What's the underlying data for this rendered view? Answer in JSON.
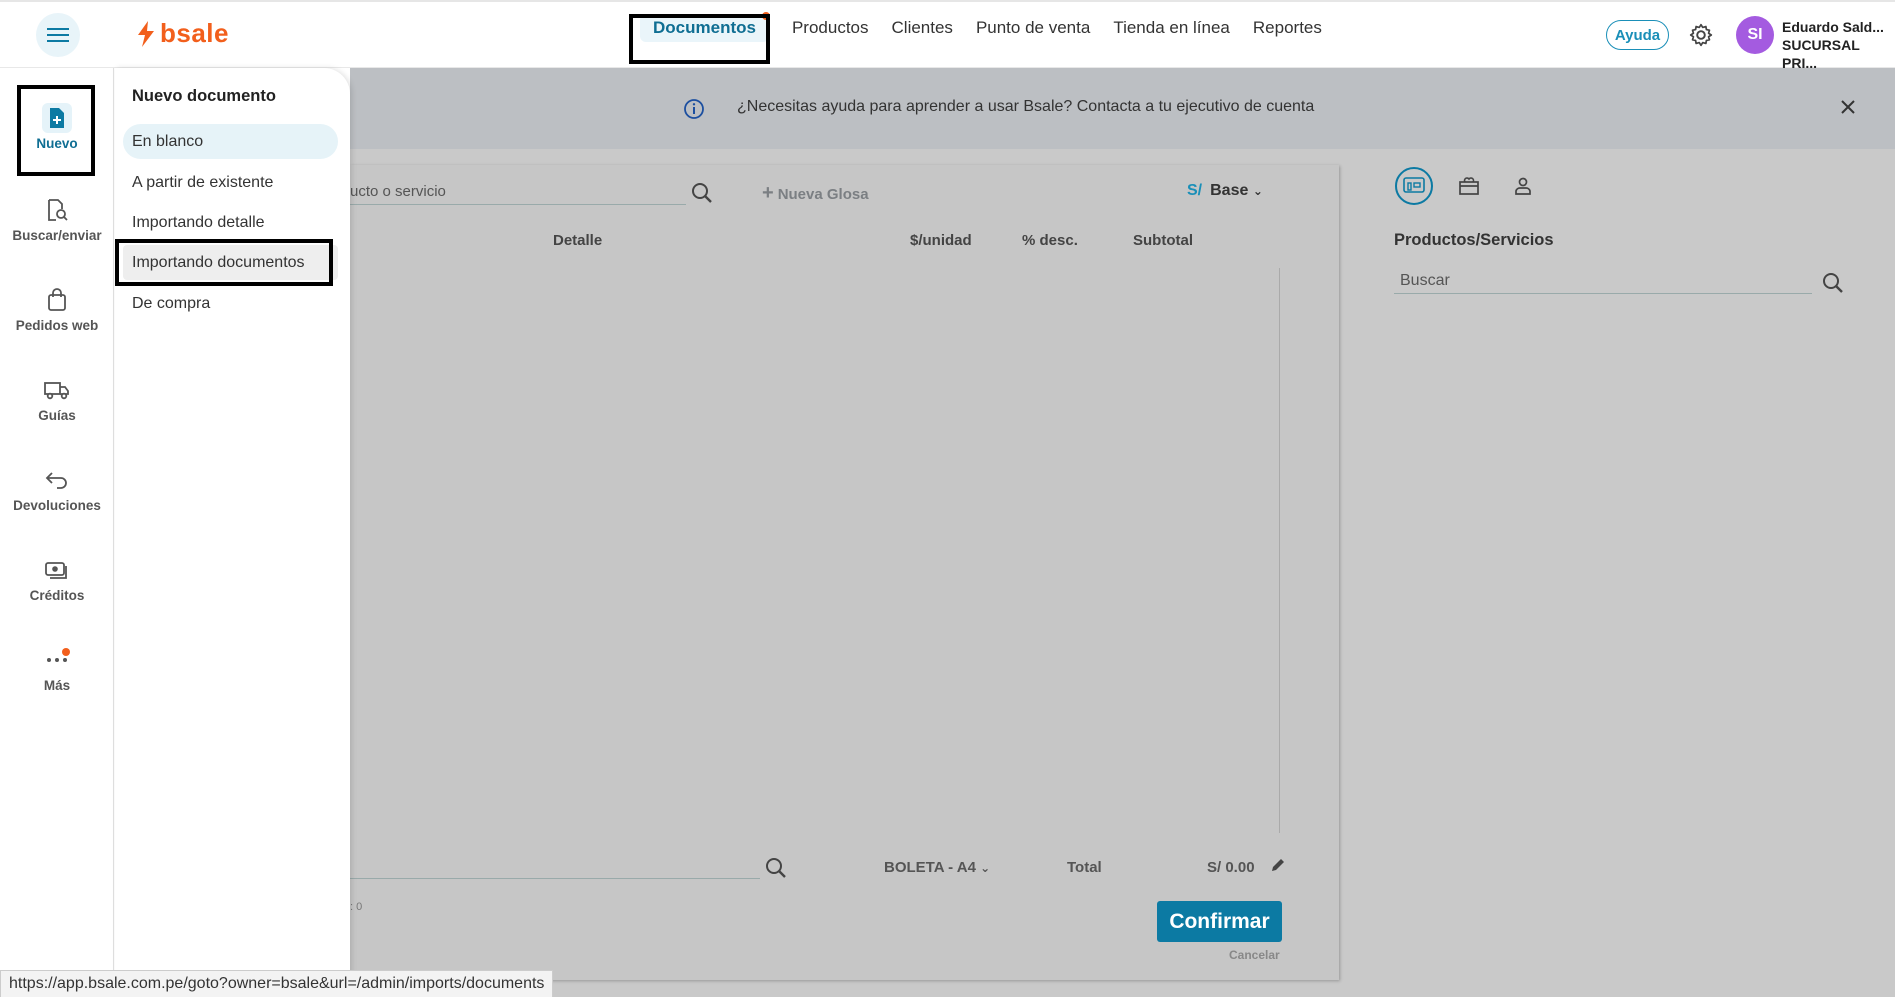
{
  "brand": {
    "name": "bsale",
    "color": "#f25f1c"
  },
  "topnav": {
    "items": [
      "Documentos",
      "Productos",
      "Clientes",
      "Punto de venta",
      "Tienda en línea",
      "Reportes"
    ],
    "active": "Documentos"
  },
  "header": {
    "help_label": "Ayuda",
    "avatar_initials": "SI",
    "user_name": "Eduardo Sald...",
    "branch": "SUCURSAL PRI..."
  },
  "sidebar": {
    "items": [
      {
        "label": "Nuevo",
        "icon": "file-plus-icon"
      },
      {
        "label": "Buscar/enviar",
        "icon": "file-search-icon"
      },
      {
        "label": "Pedidos web",
        "icon": "shopping-bag-icon"
      },
      {
        "label": "Guías",
        "icon": "truck-icon"
      },
      {
        "label": "Devoluciones",
        "icon": "return-arrow-icon"
      },
      {
        "label": "Créditos",
        "icon": "money-icon"
      },
      {
        "label": "Más",
        "icon": "more-dots-icon"
      }
    ]
  },
  "menu": {
    "title": "Nuevo documento",
    "items": [
      "En blanco",
      "A partir de existente",
      "Importando detalle",
      "Importando documentos",
      "De compra"
    ]
  },
  "banner": {
    "text": "¿Necesitas ayuda para aprender a usar Bsale? Contacta a tu ejecutivo de cuenta"
  },
  "document": {
    "search_placeholder": "ucto o servicio",
    "new_glosa": "Nueva Glosa",
    "currency_symbol": "S/",
    "price_list": "Base",
    "columns": [
      "Detalle",
      "$/unidad",
      "% desc.",
      "Subtotal"
    ],
    "doc_type": "BOLETA - A4",
    "total_label": "Total",
    "total_value": "S/ 0.00",
    "count_fragment": ": 0",
    "confirm_label": "Confirmar",
    "cancel_label": "Cancelar"
  },
  "right_panel": {
    "title": "Productos/Servicios",
    "search_placeholder": "Buscar"
  },
  "status_url": "https://app.bsale.com.pe/goto?owner=bsale&url=/admin/imports/documents",
  "colors": {
    "accent": "#0c7aa3",
    "overlay": "#c9c9c9",
    "notification": "#f25f1c"
  }
}
